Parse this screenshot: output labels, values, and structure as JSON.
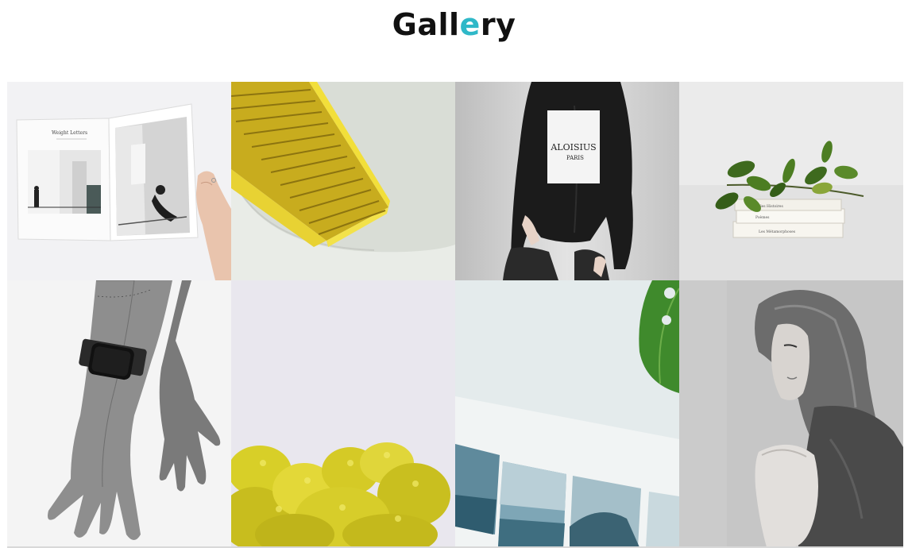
{
  "header": {
    "title_prefix": "Gall",
    "title_accent": "e",
    "title_suffix": "ry",
    "accent_color": "#2fb8c8"
  },
  "gallery": {
    "items": [
      {
        "icon": "open-magazine-photo",
        "magazine_text": "Weight Letters"
      },
      {
        "icon": "yellow-staircase-photo"
      },
      {
        "icon": "sweatshirt-model-photo",
        "print_text_line1": "ALOISIUS",
        "print_text_line2": "PARIS"
      },
      {
        "icon": "books-with-plant-photo",
        "book_text_1": "Nouvelles Histoires",
        "book_text_2": "Poèmes",
        "book_text_3": "Les Métamorphoses"
      },
      {
        "icon": "hands-with-smartwatch-photo"
      },
      {
        "icon": "yellow-flowers-photo"
      },
      {
        "icon": "ocean-photos-leaf-photo"
      },
      {
        "icon": "woman-portrait-photo"
      }
    ]
  }
}
